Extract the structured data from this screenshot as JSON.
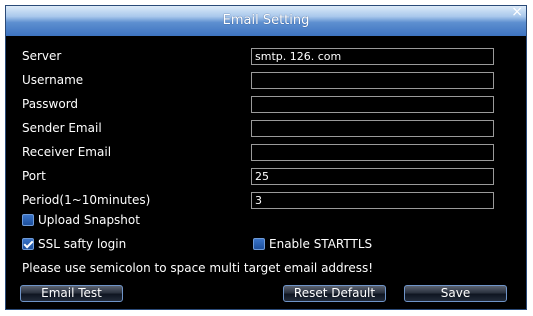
{
  "dialog": {
    "title": "Email Setting",
    "close_glyph": "×"
  },
  "fields": {
    "server": {
      "label": "Server",
      "value": "smtp. 126. com"
    },
    "username": {
      "label": "Username",
      "value": ""
    },
    "password": {
      "label": "Password",
      "value": ""
    },
    "sender_email": {
      "label": "Sender Email",
      "value": ""
    },
    "receiver_email": {
      "label": "Receiver Email",
      "value": ""
    },
    "port": {
      "label": "Port",
      "value": "25"
    },
    "period": {
      "label": "Period(1~10minutes)",
      "value": "3"
    }
  },
  "options": {
    "upload_snapshot": {
      "label": "Upload Snapshot",
      "checked": false
    },
    "ssl_login": {
      "label": "SSL safty login",
      "checked": true
    },
    "enable_starttls": {
      "label": "Enable STARTTLS",
      "checked": false
    }
  },
  "note": "Please use semicolon to space multi target email address!",
  "buttons": {
    "email_test": "Email Test",
    "reset_default": "Reset Default",
    "save": "Save"
  },
  "colors": {
    "title_bar": "#3d73c0",
    "background": "#000000",
    "checkbox": "#2a63b8",
    "text": "#ffffff"
  },
  "icons": {
    "close": "close-icon",
    "checkbox_checked": "checkmark-icon"
  }
}
